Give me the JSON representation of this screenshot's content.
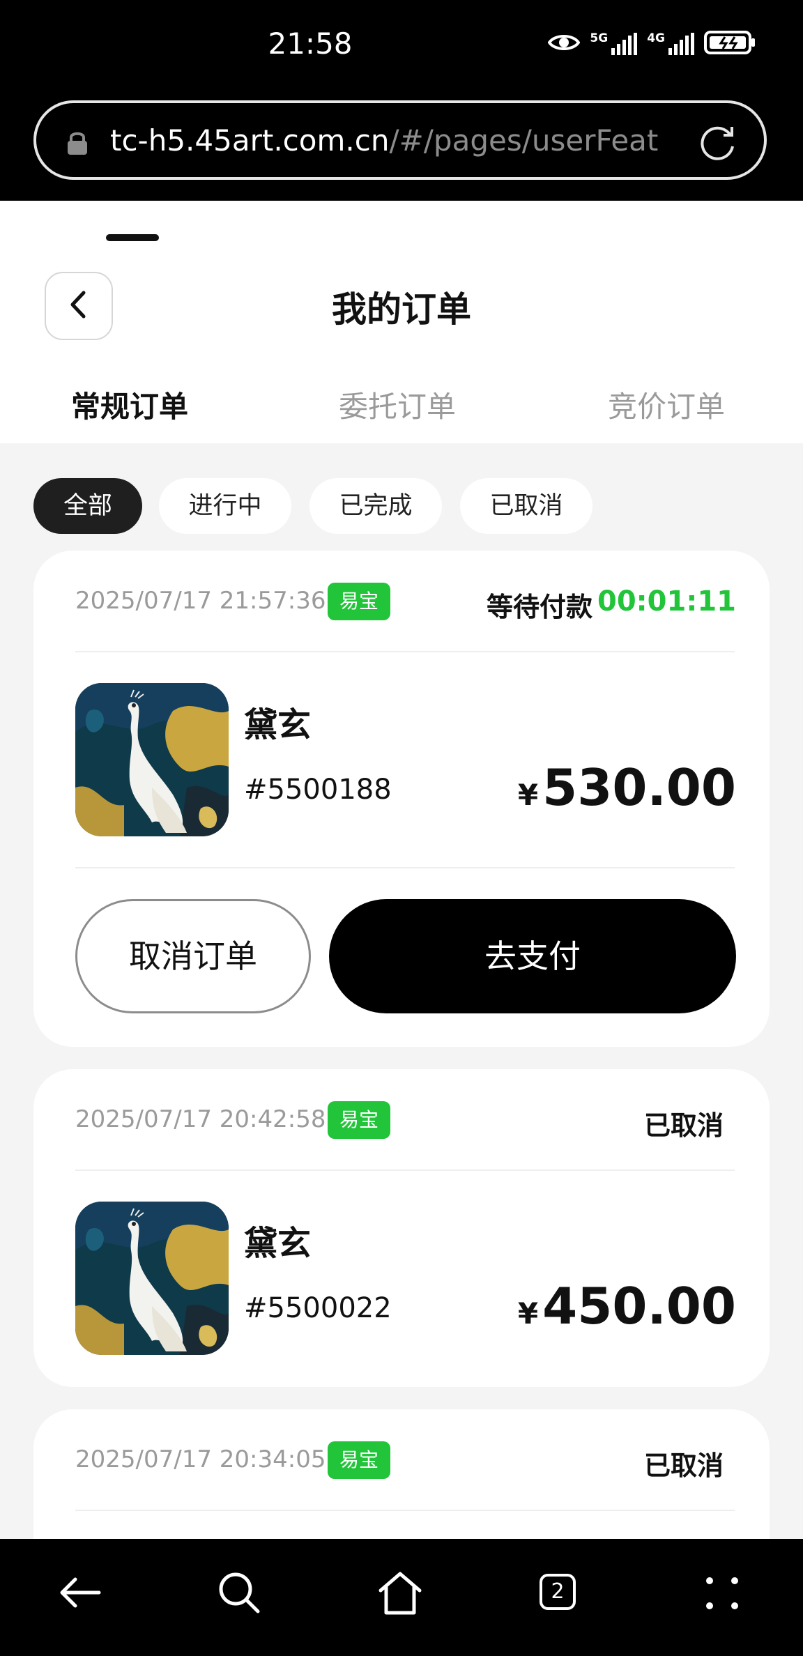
{
  "status_bar": {
    "time": "21:58",
    "signal1_label": "5G",
    "signal2_label": "4G"
  },
  "browser": {
    "url_host": "tc-h5.45art.com.cn",
    "url_path": "/#/pages/userFeat"
  },
  "header": {
    "title": "我的订单",
    "tabs": [
      {
        "label": "常规订单",
        "active": true
      },
      {
        "label": "委托订单",
        "active": false
      },
      {
        "label": "竞价订单",
        "active": false
      }
    ]
  },
  "filters": [
    {
      "label": "全部",
      "active": true
    },
    {
      "label": "进行中",
      "active": false
    },
    {
      "label": "已完成",
      "active": false
    },
    {
      "label": "已取消",
      "active": false
    }
  ],
  "orders": [
    {
      "datetime": "2025/07/17 21:57:36",
      "badge": "易宝",
      "status": "等待付款",
      "countdown": "00:01:11",
      "product_name": "黛玄",
      "product_id": "#5500188",
      "currency": "¥",
      "price": "530.00",
      "cancel_label": "取消订单",
      "pay_label": "去支付"
    },
    {
      "datetime": "2025/07/17 20:42:58",
      "badge": "易宝",
      "status": "已取消",
      "product_name": "黛玄",
      "product_id": "#5500022",
      "currency": "¥",
      "price": "450.00"
    },
    {
      "datetime": "2025/07/17 20:34:05",
      "badge": "易宝",
      "status": "已取消"
    }
  ],
  "nav_bar": {
    "tab_count": "2"
  },
  "colors": {
    "accent_green": "#22c43a",
    "primary_black": "#000000",
    "page_bg": "#f4f4f4"
  }
}
